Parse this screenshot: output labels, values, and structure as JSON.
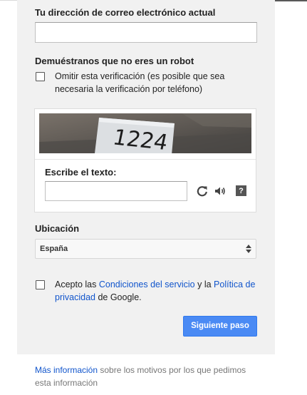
{
  "email_section": {
    "label": "Tu dirección de correo electrónico actual",
    "value": "",
    "placeholder": ""
  },
  "robot_section": {
    "title": "Demuéstranos que no eres un robot",
    "skip_checkbox_checked": false,
    "skip_label": "Omitir esta verificación (es posible que sea necesaria la verificación por teléfono)"
  },
  "captcha": {
    "image_text": "1224",
    "input_label": "Escribe el texto:",
    "input_value": "",
    "reload_icon": "refresh-icon",
    "audio_icon": "speaker-icon",
    "help_icon": "help-icon",
    "help_glyph": "?"
  },
  "location": {
    "label": "Ubicación",
    "selected": "España"
  },
  "terms": {
    "checked": false,
    "prefix": "Acepto las ",
    "tos_link": "Condiciones del servicio",
    "middle": " y la ",
    "privacy_link": "Política de privacidad",
    "suffix": " de Google."
  },
  "next_button": {
    "label": "Siguiente paso",
    "color": "#4a8af4"
  },
  "footer": {
    "link": "Más información",
    "text": " sobre los motivos por los que pedimos esta información"
  },
  "colors": {
    "panel_bg": "#f1f1f1",
    "link": "#1155cc"
  }
}
